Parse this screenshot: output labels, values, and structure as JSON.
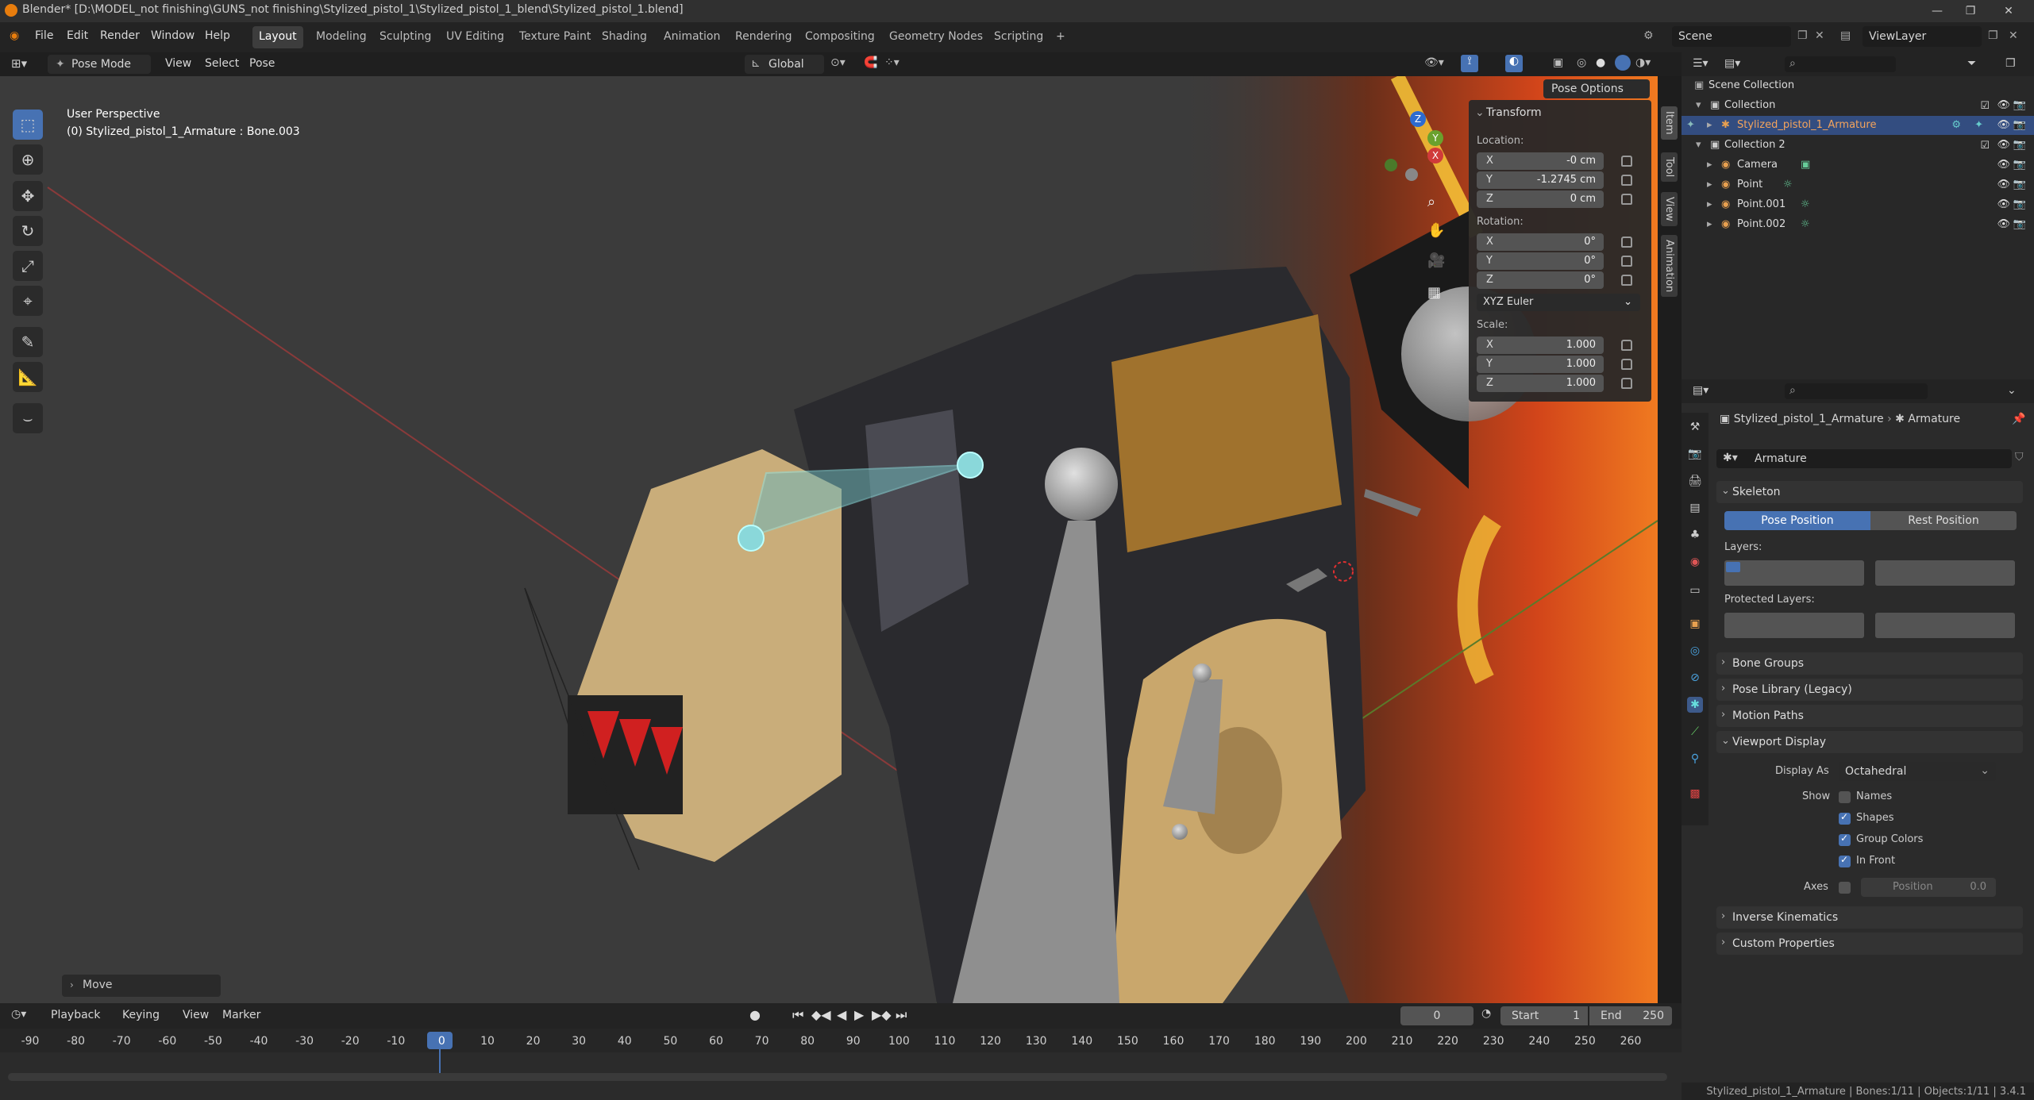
{
  "app": {
    "title": "Blender* [D:\\MODEL_not finishing\\GUNS_not finishing\\Stylized_pistol_1\\Stylized_pistol_1_blend\\Stylized_pistol_1.blend]",
    "brand_color": "#e87d0d"
  },
  "menu": {
    "items": [
      "File",
      "Edit",
      "Render",
      "Window",
      "Help"
    ],
    "workspaces": [
      "Layout",
      "Modeling",
      "Sculpting",
      "UV Editing",
      "Texture Paint",
      "Shading",
      "Animation",
      "Rendering",
      "Compositing",
      "Geometry Nodes",
      "Scripting"
    ],
    "add_tab": "+",
    "scene_label": "Scene",
    "view_layer_label": "ViewLayer"
  },
  "viewport_header": {
    "mode": "Pose Mode",
    "menus": [
      "View",
      "Select",
      "Pose"
    ],
    "transform_orientation": "Global",
    "pose_options": "Pose Options"
  },
  "viewport": {
    "perspective": "User Perspective",
    "active_info": "(0) Stylized_pistol_1_Armature : Bone.003",
    "last_op": "Move",
    "gizmo_axes": [
      "Z",
      "Y",
      "X"
    ]
  },
  "transform_panel": {
    "title": "Transform",
    "location_label": "Location:",
    "location": [
      {
        "axis": "X",
        "value": "-0 cm"
      },
      {
        "axis": "Y",
        "value": "-1.2745 cm"
      },
      {
        "axis": "Z",
        "value": "0 cm"
      }
    ],
    "rotation_label": "Rotation:",
    "rotation": [
      {
        "axis": "X",
        "value": "0°"
      },
      {
        "axis": "Y",
        "value": "0°"
      },
      {
        "axis": "Z",
        "value": "0°"
      }
    ],
    "rotation_mode": "XYZ Euler",
    "scale_label": "Scale:",
    "scale": [
      {
        "axis": "X",
        "value": "1.000"
      },
      {
        "axis": "Y",
        "value": "1.000"
      },
      {
        "axis": "Z",
        "value": "1.000"
      }
    ]
  },
  "side_tabs": [
    "Item",
    "Tool",
    "View",
    "Animation"
  ],
  "outliner": {
    "rows": [
      {
        "label": "Scene Collection"
      },
      {
        "label": "Collection"
      },
      {
        "label": "Stylized_pistol_1_Armature",
        "selected": true
      },
      {
        "label": "Collection 2"
      },
      {
        "label": "Camera"
      },
      {
        "label": "Point"
      },
      {
        "label": "Point.001"
      },
      {
        "label": "Point.002"
      }
    ]
  },
  "properties": {
    "breadcrumb_object": "Stylized_pistol_1_Armature",
    "breadcrumb_data": "Armature",
    "datablock_name": "Armature",
    "skeleton": {
      "title": "Skeleton",
      "pose_position": "Pose Position",
      "rest_position": "Rest Position",
      "layers_label": "Layers:",
      "protected_layers_label": "Protected Layers:"
    },
    "collapsed_sections": [
      "Bone Groups",
      "Pose Library (Legacy)",
      "Motion Paths"
    ],
    "viewport_display": {
      "title": "Viewport Display",
      "display_as_label": "Display As",
      "display_as": "Octahedral",
      "show_label": "Show",
      "options": [
        {
          "label": "Names",
          "checked": false
        },
        {
          "label": "Shapes",
          "checked": true
        },
        {
          "label": "Group Colors",
          "checked": true
        },
        {
          "label": "In Front",
          "checked": true
        }
      ],
      "axes_label": "Axes",
      "axes_position_label": "Position",
      "axes_position_value": "0.0"
    },
    "bottom_sections": [
      "Inverse Kinematics",
      "Custom Properties"
    ]
  },
  "timeline": {
    "menus": [
      "Playback",
      "Keying",
      "View",
      "Marker"
    ],
    "current_frame": "0",
    "start_label": "Start",
    "start": "1",
    "end_label": "End",
    "end": "250",
    "ticks": [
      "-90",
      "-80",
      "-70",
      "-60",
      "-50",
      "-40",
      "-30",
      "-20",
      "-10",
      "0",
      "10",
      "20",
      "30",
      "40",
      "50",
      "60",
      "70",
      "80",
      "90",
      "100",
      "110",
      "120",
      "130",
      "140",
      "150",
      "160",
      "170",
      "180",
      "190",
      "200",
      "210",
      "220",
      "230",
      "240",
      "250",
      "260"
    ]
  },
  "status": {
    "text": "Stylized_pistol_1_Armature | Bones:1/11 | Objects:1/11 | 3.4.1"
  }
}
